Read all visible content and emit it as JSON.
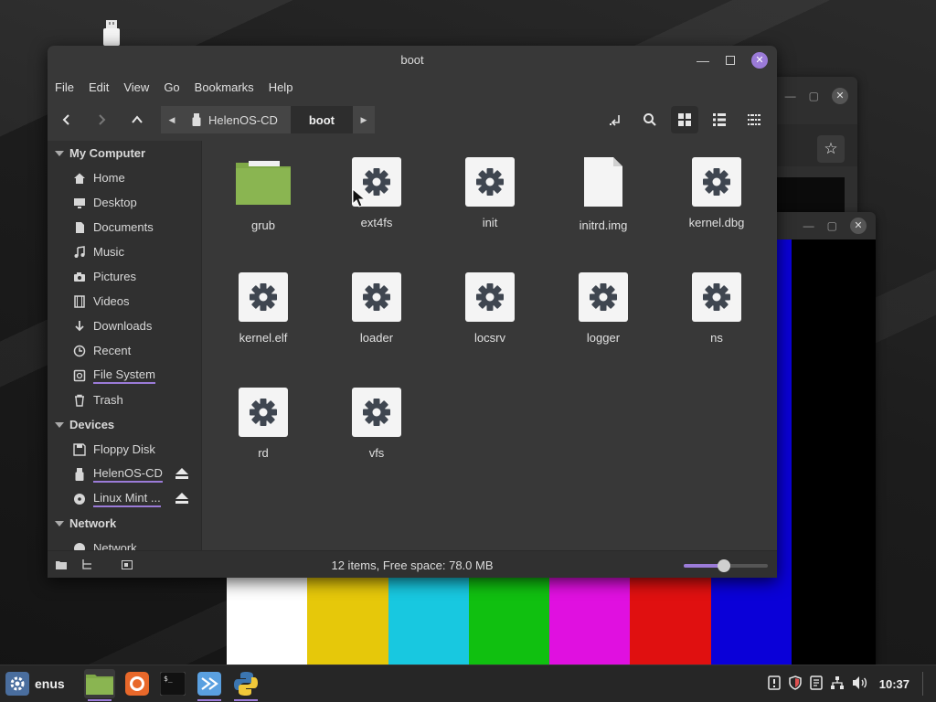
{
  "window": {
    "title": "boot"
  },
  "menubar": {
    "items": [
      "File",
      "Edit",
      "View",
      "Go",
      "Bookmarks",
      "Help"
    ]
  },
  "pathbar": {
    "crumbs": [
      "HelenOS-CD",
      "boot"
    ]
  },
  "sidebar": {
    "sections": [
      {
        "title": "My Computer",
        "items": [
          "Home",
          "Desktop",
          "Documents",
          "Music",
          "Pictures",
          "Videos",
          "Downloads",
          "Recent",
          "File System",
          "Trash"
        ]
      },
      {
        "title": "Devices",
        "items": [
          "Floppy Disk",
          "HelenOS-CD",
          "Linux Mint ..."
        ]
      },
      {
        "title": "Network",
        "items": [
          "Network"
        ]
      }
    ]
  },
  "files": [
    {
      "name": "grub",
      "type": "folder"
    },
    {
      "name": "ext4fs",
      "type": "executable"
    },
    {
      "name": "init",
      "type": "executable"
    },
    {
      "name": "initrd.img",
      "type": "document"
    },
    {
      "name": "kernel.dbg",
      "type": "executable"
    },
    {
      "name": "kernel.elf",
      "type": "executable"
    },
    {
      "name": "loader",
      "type": "executable"
    },
    {
      "name": "locsrv",
      "type": "executable"
    },
    {
      "name": "logger",
      "type": "executable"
    },
    {
      "name": "ns",
      "type": "executable"
    },
    {
      "name": "rd",
      "type": "executable"
    },
    {
      "name": "vfs",
      "type": "executable"
    }
  ],
  "statusbar": {
    "text": "12 items, Free space: 78.0 MB",
    "zoom_level": 0.48
  },
  "taskbar": {
    "menu_label": "enus",
    "clock": "10:37",
    "apps": [
      "file-manager",
      "firefox",
      "terminal",
      "qemu",
      "python"
    ]
  },
  "colors": {
    "accent": "#9b7bd8",
    "folder": "#8ab551",
    "test_bars": [
      "#ffffff",
      "#e6c80a",
      "#18c8e0",
      "#10c010",
      "#e010e0",
      "#e01010",
      "#0a00d8"
    ]
  }
}
